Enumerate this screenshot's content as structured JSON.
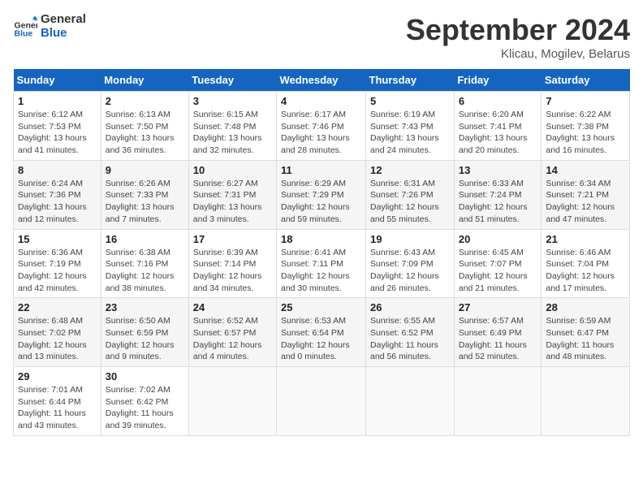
{
  "header": {
    "logo_line1": "General",
    "logo_line2": "Blue",
    "month": "September 2024",
    "location": "Klicau, Mogilev, Belarus"
  },
  "weekdays": [
    "Sunday",
    "Monday",
    "Tuesday",
    "Wednesday",
    "Thursday",
    "Friday",
    "Saturday"
  ],
  "weeks": [
    [
      {
        "day": "1",
        "sunrise": "6:12 AM",
        "sunset": "7:53 PM",
        "daylight": "13 hours and 41 minutes."
      },
      {
        "day": "2",
        "sunrise": "6:13 AM",
        "sunset": "7:50 PM",
        "daylight": "13 hours and 36 minutes."
      },
      {
        "day": "3",
        "sunrise": "6:15 AM",
        "sunset": "7:48 PM",
        "daylight": "13 hours and 32 minutes."
      },
      {
        "day": "4",
        "sunrise": "6:17 AM",
        "sunset": "7:46 PM",
        "daylight": "13 hours and 28 minutes."
      },
      {
        "day": "5",
        "sunrise": "6:19 AM",
        "sunset": "7:43 PM",
        "daylight": "13 hours and 24 minutes."
      },
      {
        "day": "6",
        "sunrise": "6:20 AM",
        "sunset": "7:41 PM",
        "daylight": "13 hours and 20 minutes."
      },
      {
        "day": "7",
        "sunrise": "6:22 AM",
        "sunset": "7:38 PM",
        "daylight": "13 hours and 16 minutes."
      }
    ],
    [
      {
        "day": "8",
        "sunrise": "6:24 AM",
        "sunset": "7:36 PM",
        "daylight": "13 hours and 12 minutes."
      },
      {
        "day": "9",
        "sunrise": "6:26 AM",
        "sunset": "7:33 PM",
        "daylight": "13 hours and 7 minutes."
      },
      {
        "day": "10",
        "sunrise": "6:27 AM",
        "sunset": "7:31 PM",
        "daylight": "13 hours and 3 minutes."
      },
      {
        "day": "11",
        "sunrise": "6:29 AM",
        "sunset": "7:29 PM",
        "daylight": "12 hours and 59 minutes."
      },
      {
        "day": "12",
        "sunrise": "6:31 AM",
        "sunset": "7:26 PM",
        "daylight": "12 hours and 55 minutes."
      },
      {
        "day": "13",
        "sunrise": "6:33 AM",
        "sunset": "7:24 PM",
        "daylight": "12 hours and 51 minutes."
      },
      {
        "day": "14",
        "sunrise": "6:34 AM",
        "sunset": "7:21 PM",
        "daylight": "12 hours and 47 minutes."
      }
    ],
    [
      {
        "day": "15",
        "sunrise": "6:36 AM",
        "sunset": "7:19 PM",
        "daylight": "12 hours and 42 minutes."
      },
      {
        "day": "16",
        "sunrise": "6:38 AM",
        "sunset": "7:16 PM",
        "daylight": "12 hours and 38 minutes."
      },
      {
        "day": "17",
        "sunrise": "6:39 AM",
        "sunset": "7:14 PM",
        "daylight": "12 hours and 34 minutes."
      },
      {
        "day": "18",
        "sunrise": "6:41 AM",
        "sunset": "7:11 PM",
        "daylight": "12 hours and 30 minutes."
      },
      {
        "day": "19",
        "sunrise": "6:43 AM",
        "sunset": "7:09 PM",
        "daylight": "12 hours and 26 minutes."
      },
      {
        "day": "20",
        "sunrise": "6:45 AM",
        "sunset": "7:07 PM",
        "daylight": "12 hours and 21 minutes."
      },
      {
        "day": "21",
        "sunrise": "6:46 AM",
        "sunset": "7:04 PM",
        "daylight": "12 hours and 17 minutes."
      }
    ],
    [
      {
        "day": "22",
        "sunrise": "6:48 AM",
        "sunset": "7:02 PM",
        "daylight": "12 hours and 13 minutes."
      },
      {
        "day": "23",
        "sunrise": "6:50 AM",
        "sunset": "6:59 PM",
        "daylight": "12 hours and 9 minutes."
      },
      {
        "day": "24",
        "sunrise": "6:52 AM",
        "sunset": "6:57 PM",
        "daylight": "12 hours and 4 minutes."
      },
      {
        "day": "25",
        "sunrise": "6:53 AM",
        "sunset": "6:54 PM",
        "daylight": "12 hours and 0 minutes."
      },
      {
        "day": "26",
        "sunrise": "6:55 AM",
        "sunset": "6:52 PM",
        "daylight": "11 hours and 56 minutes."
      },
      {
        "day": "27",
        "sunrise": "6:57 AM",
        "sunset": "6:49 PM",
        "daylight": "11 hours and 52 minutes."
      },
      {
        "day": "28",
        "sunrise": "6:59 AM",
        "sunset": "6:47 PM",
        "daylight": "11 hours and 48 minutes."
      }
    ],
    [
      {
        "day": "29",
        "sunrise": "7:01 AM",
        "sunset": "6:44 PM",
        "daylight": "11 hours and 43 minutes."
      },
      {
        "day": "30",
        "sunrise": "7:02 AM",
        "sunset": "6:42 PM",
        "daylight": "11 hours and 39 minutes."
      },
      null,
      null,
      null,
      null,
      null
    ]
  ]
}
